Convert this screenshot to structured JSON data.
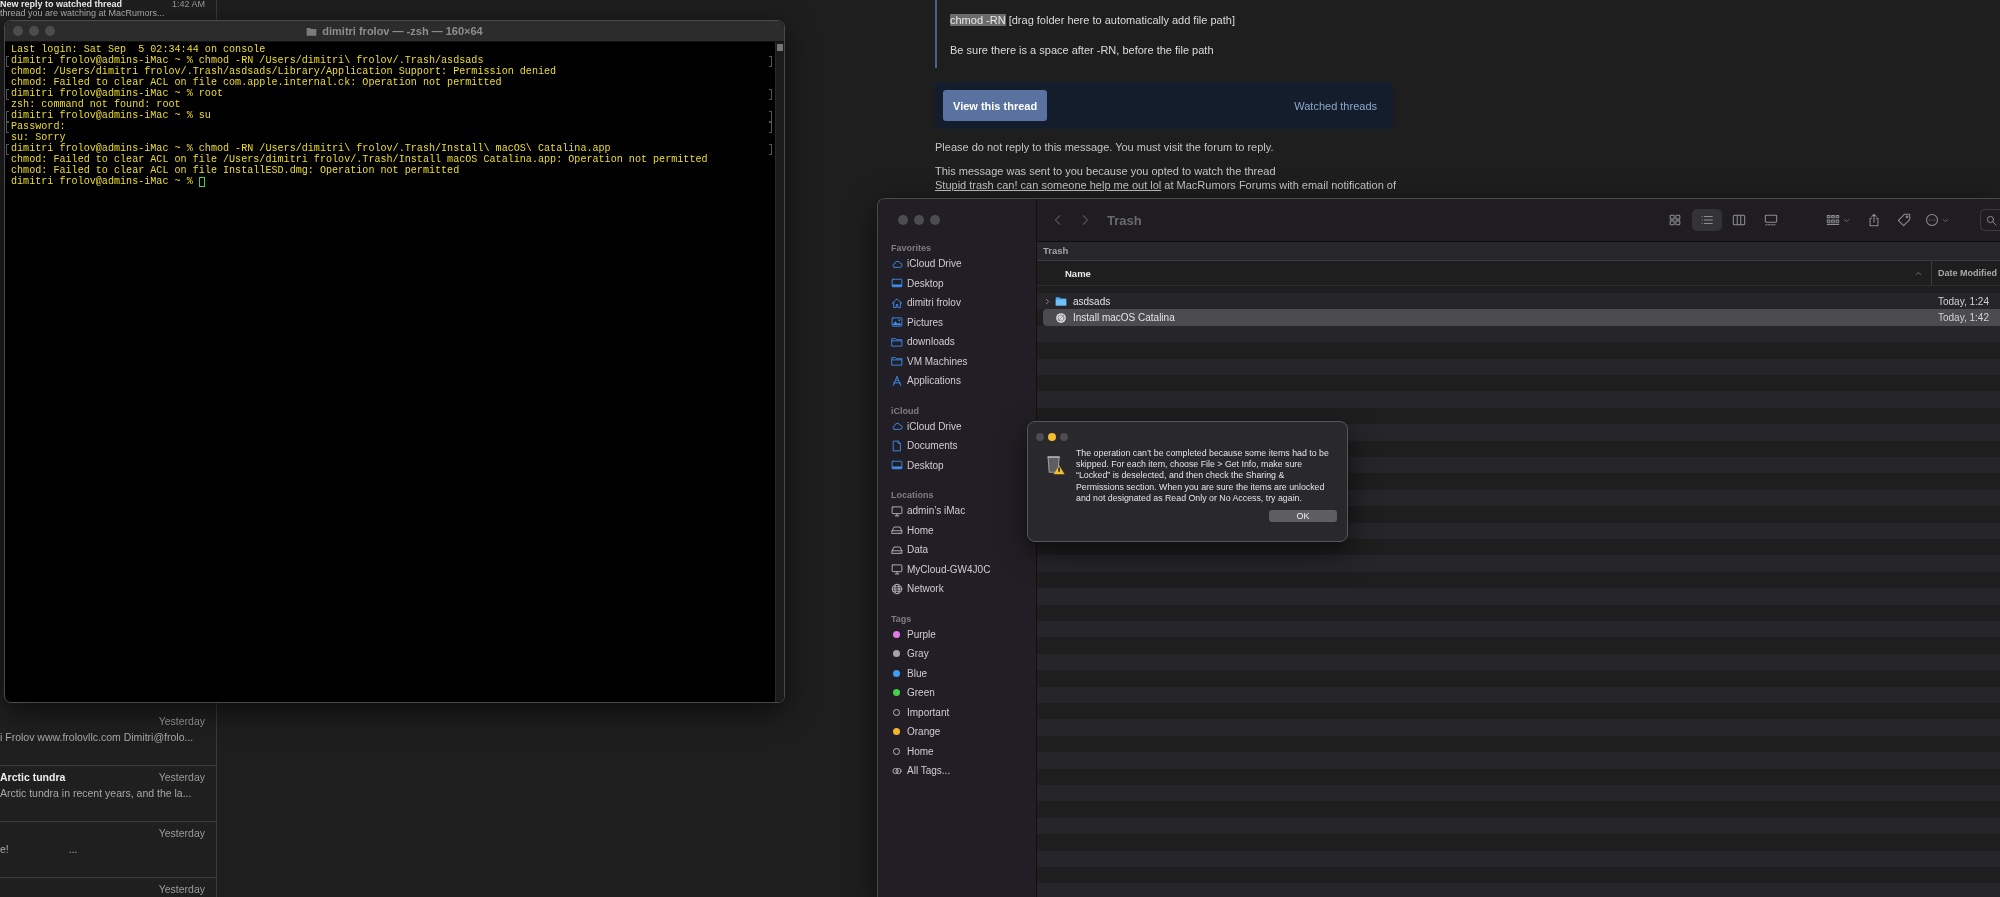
{
  "mail_list": {
    "items": [
      {
        "title": "New reply to watched thread",
        "time": "1:42 AM",
        "preview": "thread you are watching at MacRumors..."
      },
      {
        "time": "Yesterday",
        "preview": "i Frolov www.frolovllc.com Dimitri@frolo..."
      },
      {
        "title": "Arctic tundra",
        "time": "Yesterday",
        "preview": "Arctic tundra in recent years, and the la..."
      },
      {
        "time": "Yesterday",
        "preview": "e!",
        "preview_end": "..."
      },
      {
        "time": "Yesterday"
      }
    ]
  },
  "email": {
    "quote": {
      "highlighted": "chmod -RN",
      "rest": "[drag folder here to automatically add file path]",
      "note": "Be sure there is a space after -RN, before the file path"
    },
    "actions": {
      "button": "View this thread",
      "link": "Watched threads"
    },
    "notice": "Please do not reply to this message. You must visit the forum to reply.",
    "footer": {
      "before": "This message was sent to you because you opted to watch the thread",
      "link": "Stupid trash can! can someone help me out lol",
      "after": "at MacRumors Forums with email notification of"
    }
  },
  "terminal": {
    "title": "dimitri frolov — -zsh — 160×64",
    "cursor": true,
    "lines": [
      {
        "text": "Last login: Sat Sep  5 02:34:44 on console",
        "marked": false
      },
      {
        "text": "dimitri frolov@admins-iMac ~ % chmod -RN /Users/dimitri\\ frolov/.Trash/asdsads",
        "marked": true
      },
      {
        "text": "chmod: /Users/dimitri frolov/.Trash/asdsads/Library/Application Support: Permission denied",
        "marked": false
      },
      {
        "text": "chmod: Failed to clear ACL on file com.apple.internal.ck: Operation not permitted",
        "marked": false
      },
      {
        "text": "dimitri frolov@admins-iMac ~ % root",
        "marked": true
      },
      {
        "text": "zsh: command not found: root",
        "marked": false
      },
      {
        "text": "dimitri frolov@admins-iMac ~ % su",
        "marked": true
      },
      {
        "text": "Password:",
        "marked": true
      },
      {
        "text": "su: Sorry",
        "marked": false
      },
      {
        "text": "dimitri frolov@admins-iMac ~ % chmod -RN /Users/dimitri\\ frolov/.Trash/Install\\ macOS\\ Catalina.app",
        "marked": true
      },
      {
        "text": "chmod: Failed to clear ACL on file /Users/dimitri frolov/.Trash/Install macOS Catalina.app: Operation not permitted",
        "marked": false
      },
      {
        "text": "chmod: Failed to clear ACL on file InstallESD.dmg: Operation not permitted",
        "marked": false
      },
      {
        "text": "dimitri frolov@admins-iMac ~ % ",
        "marked": false
      }
    ]
  },
  "finder": {
    "sidebar": [
      {
        "header": "Favorites",
        "items": [
          {
            "label": "iCloud Drive",
            "kind": "cloud"
          },
          {
            "label": "Desktop",
            "kind": "display"
          },
          {
            "label": "dimitri frolov",
            "kind": "home"
          },
          {
            "label": "Pictures",
            "kind": "photo"
          },
          {
            "label": "downloads",
            "kind": "folder"
          },
          {
            "label": "VM Machines",
            "kind": "folder"
          },
          {
            "label": "Applications",
            "kind": "apps"
          }
        ]
      },
      {
        "header": "iCloud",
        "items": [
          {
            "label": "iCloud Drive",
            "kind": "cloud"
          },
          {
            "label": "Documents",
            "kind": "document"
          },
          {
            "label": "Desktop",
            "kind": "display"
          }
        ]
      },
      {
        "header": "Locations",
        "items": [
          {
            "label": "admin’s iMac",
            "kind": "computer"
          },
          {
            "label": "Home",
            "kind": "drive"
          },
          {
            "label": "Data",
            "kind": "drive"
          },
          {
            "label": "MyCloud-GW4J0C",
            "kind": "computer"
          },
          {
            "label": "Network",
            "kind": "globe"
          }
        ]
      },
      {
        "header": "Tags",
        "items": [
          {
            "label": "Purple",
            "kind": "tag",
            "color": "#e27ae6"
          },
          {
            "label": "Gray",
            "kind": "tag",
            "color": "#a4a4a8"
          },
          {
            "label": "Blue",
            "kind": "tag",
            "color": "#3b9ff3"
          },
          {
            "label": "Green",
            "kind": "tag",
            "color": "#44d04a"
          },
          {
            "label": "Important",
            "kind": "tag"
          },
          {
            "label": "Orange",
            "kind": "tag",
            "color": "#f4b52a"
          },
          {
            "label": "Home",
            "kind": "tag"
          },
          {
            "label": "All Tags...",
            "kind": "all-tags"
          }
        ]
      }
    ],
    "toolbar": {
      "title": "Trash",
      "views": [
        {
          "kind": "icons",
          "selected": false
        },
        {
          "kind": "list",
          "selected": true
        },
        {
          "kind": "columns",
          "selected": false
        },
        {
          "kind": "gallery",
          "selected": false
        }
      ]
    },
    "path": "Trash",
    "columns": [
      {
        "label": "Name",
        "sorted": true
      },
      {
        "label": "Date Modified"
      }
    ],
    "files": [
      {
        "name": "asdsads",
        "kind": "folder",
        "date": "Today, 1:24",
        "selected": false,
        "expanded": false
      },
      {
        "name": "Install macOS Catalina",
        "kind": "app",
        "date": "Today, 1:42",
        "selected": true
      }
    ]
  },
  "dialog": {
    "message": "The operation can’t be completed because some items had to be skipped. For each item, choose File > Get Info, make sure “Locked” is deselected, and then check the Sharing & Permissions section. When you are sure the items are unlocked and not designated as Read Only or No Access, try again.",
    "button": "OK"
  }
}
